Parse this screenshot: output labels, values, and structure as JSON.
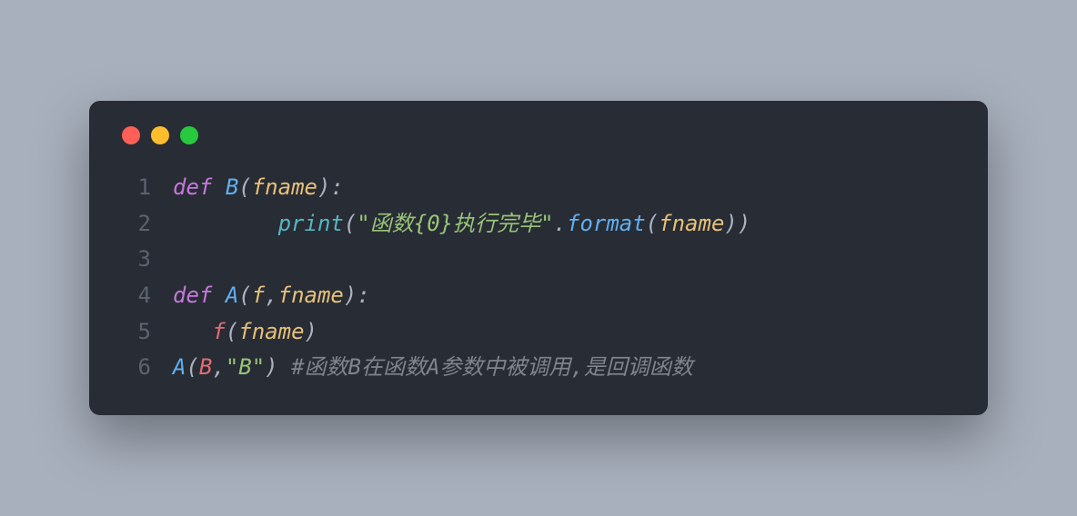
{
  "lines": {
    "l1_no": "1",
    "l1_def": "def",
    "l1_name": "B",
    "l1_paren_open": "(",
    "l1_param": "fname",
    "l1_paren_close": ")",
    "l1_colon": ":",
    "l2_no": "2",
    "l2_indent": "        ",
    "l2_print": "print",
    "l2_paren_open": "(",
    "l2_string": "\"函数{0}执行完毕\"",
    "l2_dot": ".",
    "l2_format": "format",
    "l2_paren_open2": "(",
    "l2_arg": "fname",
    "l2_paren_close2": ")",
    "l2_paren_close": ")",
    "l3_no": "3",
    "l4_no": "4",
    "l4_def": "def",
    "l4_name": "A",
    "l4_paren_open": "(",
    "l4_param1": "f",
    "l4_comma": ",",
    "l4_param2": "fname",
    "l4_paren_close": ")",
    "l4_colon": ":",
    "l5_no": "5",
    "l5_indent": "   ",
    "l5_f": "f",
    "l5_paren_open": "(",
    "l5_arg": "fname",
    "l5_paren_close": ")",
    "l6_no": "6",
    "l6_A": "A",
    "l6_paren_open": "(",
    "l6_B": "B",
    "l6_comma": ",",
    "l6_str": "\"B\"",
    "l6_paren_close": ")",
    "l6_space": " ",
    "l6_comment": "#函数B在函数A参数中被调用,是回调函数"
  }
}
